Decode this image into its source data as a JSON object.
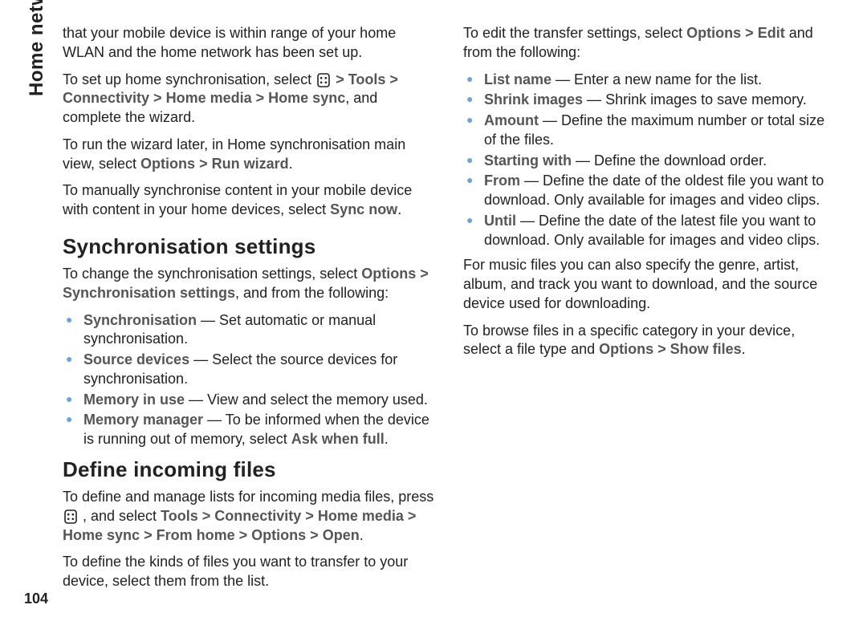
{
  "sideTab": "Home network",
  "pageNumber": "104",
  "sep": ">",
  "col1": {
    "intro": "that your mobile device is within range of your home WLAN and the home network has been set up.",
    "p2_lead": "To set up home synchronisation, select ",
    "p2_icon": "home-key",
    "p2_path": [
      "Tools",
      "Connectivity",
      "Home media",
      "Home sync"
    ],
    "p2_tail": ", and complete the wizard.",
    "p3_lead": "To run the wizard later, in Home synchronisation main view, select ",
    "p3_path": [
      "Options",
      "Run wizard"
    ],
    "p3_tail": ".",
    "p4_lead": "To manually synchronise content in your mobile device with content in your home devices, select ",
    "p4_bold": "Sync now",
    "p4_tail": ".",
    "h2": "Synchronisation settings",
    "p5_lead": "To change the synchronisation settings, select ",
    "p5_path": [
      "Options",
      "Synchronisation settings"
    ],
    "p5_tail": ", and from the following:",
    "items": [
      {
        "term": "Synchronisation",
        "desc": "Set automatic or manual synchronisation."
      },
      {
        "term": "Source devices",
        "desc": "Select the source devices for synchronisation."
      },
      {
        "term": "Memory in use",
        "desc": "View and select the memory used."
      },
      {
        "term": "Memory manager",
        "desc_pre": "To be informed when the device is running out of memory, select ",
        "desc_bold": "Ask when full",
        "desc_post": "."
      }
    ]
  },
  "col2": {
    "h2": "Define incoming files",
    "p1_lead": "To define and manage lists for incoming media files, press ",
    "p1_icon": "home-key",
    "p1_mid": " , and select ",
    "p1_path": [
      "Tools",
      "Connectivity",
      "Home media",
      "Home sync",
      "From home",
      "Options",
      "Open"
    ],
    "p1_tail": ".",
    "p2": "To define the kinds of files you want to transfer to your device, select them from the list.",
    "p3_lead": "To edit the transfer settings, select ",
    "p3_path": [
      "Options",
      "Edit"
    ],
    "p3_tail": " and from the following:",
    "items": [
      {
        "term": "List name",
        "desc": "Enter a new name for the list."
      },
      {
        "term": "Shrink images",
        "desc": "Shrink images to save memory."
      },
      {
        "term": "Amount",
        "desc": "Define the maximum number or total size of the files."
      },
      {
        "term": "Starting with",
        "desc": "Define the download order."
      },
      {
        "term": "From",
        "desc": "Define the date of the oldest file you want to download. Only available for images and video clips."
      },
      {
        "term": "Until",
        "desc": "Define the date of the latest file you want to download. Only available for images and video clips."
      }
    ],
    "p4": "For music files you can also specify the genre, artist, album, and track you want to download, and the source device used for downloading.",
    "p5_lead": "To browse files in a specific category in your device, select a file type and ",
    "p5_path": [
      "Options",
      "Show files"
    ],
    "p5_tail": "."
  }
}
